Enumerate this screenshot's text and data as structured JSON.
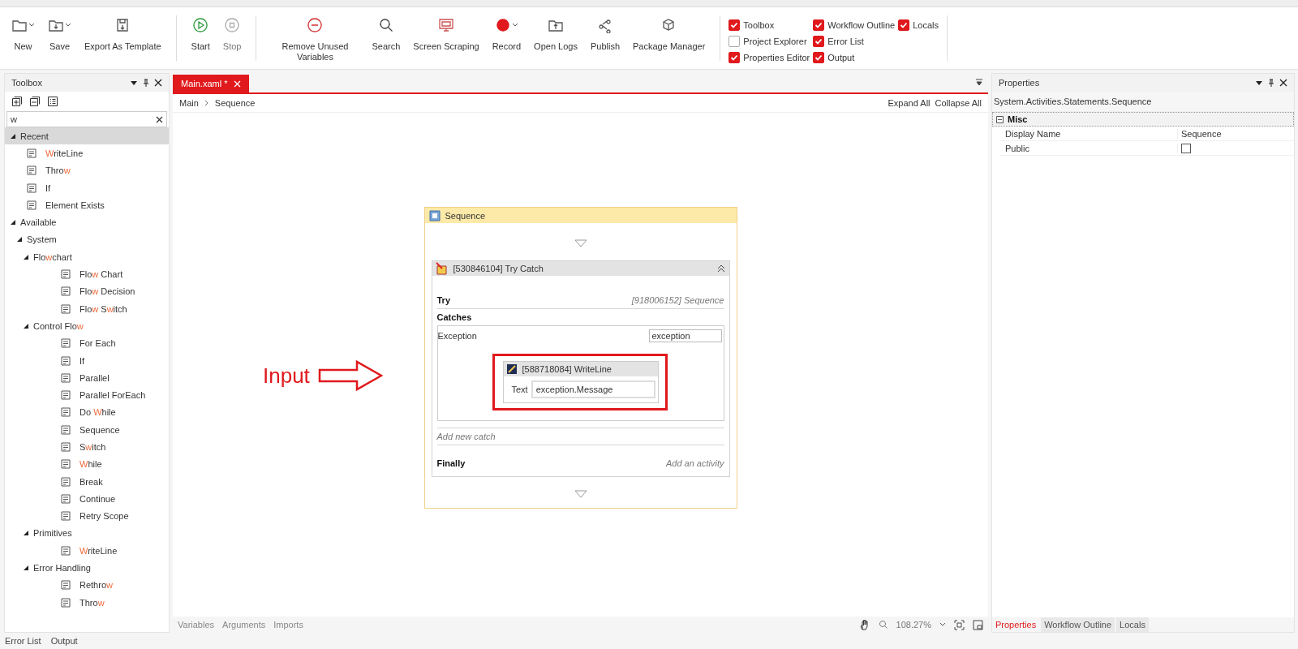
{
  "toolbar": {
    "groups": [
      {
        "buttons": [
          {
            "label": "New",
            "dropdown": true,
            "disabled": false
          },
          {
            "label": "Save",
            "dropdown": true,
            "disabled": false
          },
          {
            "label": "Export As Template",
            "dropdown": false,
            "disabled": false
          }
        ]
      },
      {
        "buttons": [
          {
            "label": "Start",
            "dropdown": false,
            "disabled": false
          },
          {
            "label": "Stop",
            "dropdown": false,
            "disabled": true
          }
        ]
      },
      {
        "buttons": [
          {
            "label": "Remove Unused Variables",
            "dropdown": false,
            "disabled": false
          },
          {
            "label": "Search",
            "dropdown": false,
            "disabled": false
          },
          {
            "label": "Screen Scraping",
            "dropdown": false,
            "disabled": false
          },
          {
            "label": "Record",
            "dropdown": true,
            "disabled": false
          },
          {
            "label": "Open Logs",
            "dropdown": false,
            "disabled": false
          },
          {
            "label": "Publish",
            "dropdown": false,
            "disabled": false
          },
          {
            "label": "Package Manager",
            "dropdown": false,
            "disabled": false
          }
        ]
      }
    ],
    "panel_checks": [
      {
        "label": "Toolbox",
        "checked": true
      },
      {
        "label": "Project Explorer",
        "checked": false
      },
      {
        "label": "Properties Editor",
        "checked": true
      },
      {
        "label": "Workflow Outline",
        "checked": true
      },
      {
        "label": "Error List",
        "checked": true
      },
      {
        "label": "Output",
        "checked": true
      },
      {
        "label": "Locals",
        "checked": true
      }
    ]
  },
  "toolbox": {
    "title": "Toolbox",
    "search": {
      "value": "w"
    },
    "tree": [
      {
        "segments": [
          {
            "text": "Recent",
            "match": false
          }
        ],
        "selected": true,
        "expanded": true,
        "children": [
          {
            "segments": [
              {
                "text": "W",
                "match": true
              },
              {
                "text": "riteLine",
                "match": false
              }
            ],
            "selected": false
          },
          {
            "segments": [
              {
                "text": "Thro",
                "match": false
              },
              {
                "text": "w",
                "match": true
              }
            ],
            "selected": false
          },
          {
            "segments": [
              {
                "text": "If",
                "match": false
              }
            ],
            "selected": false
          },
          {
            "segments": [
              {
                "text": "Element Exists",
                "match": false
              }
            ],
            "selected": false
          }
        ]
      },
      {
        "segments": [
          {
            "text": "Available",
            "match": false
          }
        ],
        "selected": false,
        "expanded": true,
        "children": [
          {
            "segments": [
              {
                "text": "System",
                "match": false
              }
            ],
            "selected": false,
            "expanded": true,
            "children": [
              {
                "segments": [
                  {
                    "text": "Flo",
                    "match": false
                  },
                  {
                    "text": "w",
                    "match": true
                  },
                  {
                    "text": "chart",
                    "match": false
                  }
                ],
                "selected": false,
                "expanded": true,
                "children": [
                  {
                    "segments": [
                      {
                        "text": "Flo",
                        "match": false
                      },
                      {
                        "text": "w",
                        "match": true
                      },
                      {
                        "text": " Chart",
                        "match": false
                      }
                    ],
                    "selected": false
                  },
                  {
                    "segments": [
                      {
                        "text": "Flo",
                        "match": false
                      },
                      {
                        "text": "w",
                        "match": true
                      },
                      {
                        "text": " Decision",
                        "match": false
                      }
                    ],
                    "selected": false
                  },
                  {
                    "segments": [
                      {
                        "text": "Flo",
                        "match": false
                      },
                      {
                        "text": "w",
                        "match": true
                      },
                      {
                        "text": " S",
                        "match": false
                      },
                      {
                        "text": "w",
                        "match": true
                      },
                      {
                        "text": "itch",
                        "match": false
                      }
                    ],
                    "selected": false
                  }
                ]
              },
              {
                "segments": [
                  {
                    "text": "Control Flo",
                    "match": false
                  },
                  {
                    "text": "w",
                    "match": true
                  }
                ],
                "selected": false,
                "expanded": true,
                "children": [
                  {
                    "segments": [
                      {
                        "text": "For Each",
                        "match": false
                      }
                    ],
                    "selected": false
                  },
                  {
                    "segments": [
                      {
                        "text": "If",
                        "match": false
                      }
                    ],
                    "selected": false
                  },
                  {
                    "segments": [
                      {
                        "text": "Parallel",
                        "match": false
                      }
                    ],
                    "selected": false
                  },
                  {
                    "segments": [
                      {
                        "text": "Parallel ForEach",
                        "match": false
                      }
                    ],
                    "selected": false
                  },
                  {
                    "segments": [
                      {
                        "text": "Do ",
                        "match": false
                      },
                      {
                        "text": "W",
                        "match": true
                      },
                      {
                        "text": "hile",
                        "match": false
                      }
                    ],
                    "selected": false
                  },
                  {
                    "segments": [
                      {
                        "text": "Sequence",
                        "match": false
                      }
                    ],
                    "selected": false
                  },
                  {
                    "segments": [
                      {
                        "text": "S",
                        "match": false
                      },
                      {
                        "text": "w",
                        "match": true
                      },
                      {
                        "text": "itch",
                        "match": false
                      }
                    ],
                    "selected": false
                  },
                  {
                    "segments": [
                      {
                        "text": "W",
                        "match": true
                      },
                      {
                        "text": "hile",
                        "match": false
                      }
                    ],
                    "selected": false
                  },
                  {
                    "segments": [
                      {
                        "text": "Break",
                        "match": false
                      }
                    ],
                    "selected": false
                  },
                  {
                    "segments": [
                      {
                        "text": "Continue",
                        "match": false
                      }
                    ],
                    "selected": false
                  },
                  {
                    "segments": [
                      {
                        "text": "Retry Scope",
                        "match": false
                      }
                    ],
                    "selected": false
                  }
                ]
              },
              {
                "segments": [
                  {
                    "text": "Primitives",
                    "match": false
                  }
                ],
                "selected": false,
                "expanded": true,
                "children": [
                  {
                    "segments": [
                      {
                        "text": "W",
                        "match": true
                      },
                      {
                        "text": "riteLine",
                        "match": false
                      }
                    ],
                    "selected": false
                  }
                ]
              },
              {
                "segments": [
                  {
                    "text": "Error Handling",
                    "match": false
                  }
                ],
                "selected": false,
                "expanded": true,
                "children": [
                  {
                    "segments": [
                      {
                        "text": "Rethro",
                        "match": false
                      },
                      {
                        "text": "w",
                        "match": true
                      }
                    ],
                    "selected": false
                  },
                  {
                    "segments": [
                      {
                        "text": "Thro",
                        "match": false
                      },
                      {
                        "text": "w",
                        "match": true
                      }
                    ],
                    "selected": false
                  }
                ]
              }
            ]
          }
        ]
      }
    ]
  },
  "designer": {
    "tab": {
      "label": "Main.xaml *",
      "selected": true
    },
    "breadcrumb": [
      "Main",
      "Sequence"
    ],
    "actions": [
      "Expand All",
      "Collapse All"
    ],
    "sequence": {
      "title": "Sequence",
      "try_catch": {
        "title": "[530846104] Try Catch",
        "try_label": "Try",
        "try_body": "[918006152] Sequence",
        "catches_label": "Catches",
        "catch": {
          "exception_type": "Exception",
          "variable": "exception",
          "activity": {
            "title": "[588718084] WriteLine",
            "field_label": "Text",
            "field_value": "exception.Message"
          }
        },
        "add_catch": "Add new catch",
        "finally_label": "Finally",
        "finally_body": "Add an activity"
      }
    },
    "annotation": {
      "label": "Input"
    },
    "bottom_tabs": [
      "Variables",
      "Arguments",
      "Imports"
    ],
    "zoom": "108.27%"
  },
  "properties": {
    "title": "Properties",
    "type_name": "System.Activities.Statements.Sequence",
    "category": {
      "name": "Misc",
      "expanded": true
    },
    "rows": [
      {
        "name": "Display Name",
        "kind": "text",
        "value": "Sequence"
      },
      {
        "name": "Public",
        "kind": "checkbox",
        "checked": false
      }
    ],
    "tabs": [
      {
        "label": "Properties",
        "selected": true
      },
      {
        "label": "Workflow Outline",
        "selected": false
      },
      {
        "label": "Locals",
        "selected": false
      }
    ]
  },
  "status_bar": [
    "Error List",
    "Output"
  ]
}
